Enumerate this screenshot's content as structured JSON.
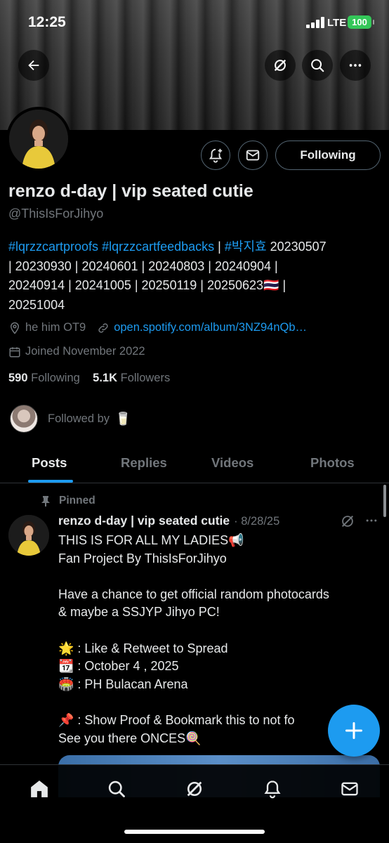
{
  "status_bar": {
    "time": "12:25",
    "network": "LTE",
    "battery": "100"
  },
  "profile": {
    "display_name": "renzo d-day | vip seated cutie",
    "handle": "@ThisIsForJihyo",
    "following_button": "Following",
    "bio_tags": [
      "#lqrzzcartproofs",
      "#lqrzzcartfeedbacks",
      "#박지효"
    ],
    "bio_sep": "|",
    "bio_dates_line1": "20230507",
    "bio_dates_line2": "| 20230930 | 20240601 | 20240803 | 20240904 |",
    "bio_dates_line3": "20240914 | 20241005 | 20250119 | 20250623🇹🇭 |",
    "bio_dates_line4": "20251004",
    "location": "he him OT9",
    "link": "open.spotify.com/album/3NZ94nQb…",
    "joined": "Joined November 2022",
    "following_count": "590",
    "following_label": "Following",
    "followers_count": "5.1K",
    "followers_label": "Followers",
    "followed_by_label": "Followed by",
    "followed_by_emoji": "🥛"
  },
  "tabs": [
    "Posts",
    "Replies",
    "Videos",
    "Photos"
  ],
  "pinned_post": {
    "pinned_label": "Pinned",
    "author": "renzo d-day | vip seated cutie",
    "date": "· 8/28/25",
    "body": "THIS IS FOR ALL MY LADIES📢\nFan Project By ThisIsForJihyo\n\nHave a chance to get official random photocards\n& maybe a SSJYP Jihyo PC!\n\n🌟 : Like & Retweet to Spread\n📆 : October 4 , 2025\n🏟️ : PH Bulacan Arena\n\n📌 : Show Proof & Bookmark this to not fo\nSee you there ONCES🍭"
  },
  "colors": {
    "accent": "#1d9bf0",
    "muted": "#71767b",
    "text": "#e7e9ea",
    "battery": "#34c759"
  },
  "icons": [
    "back-arrow-icon",
    "grok-icon",
    "search-icon",
    "more-icon",
    "notification-bell-plus-icon",
    "mail-icon",
    "location-icon",
    "link-icon",
    "calendar-icon",
    "pin-icon",
    "home-icon",
    "search-nav-icon",
    "grok-nav-icon",
    "bell-icon",
    "mail-nav-icon",
    "plus-icon"
  ]
}
